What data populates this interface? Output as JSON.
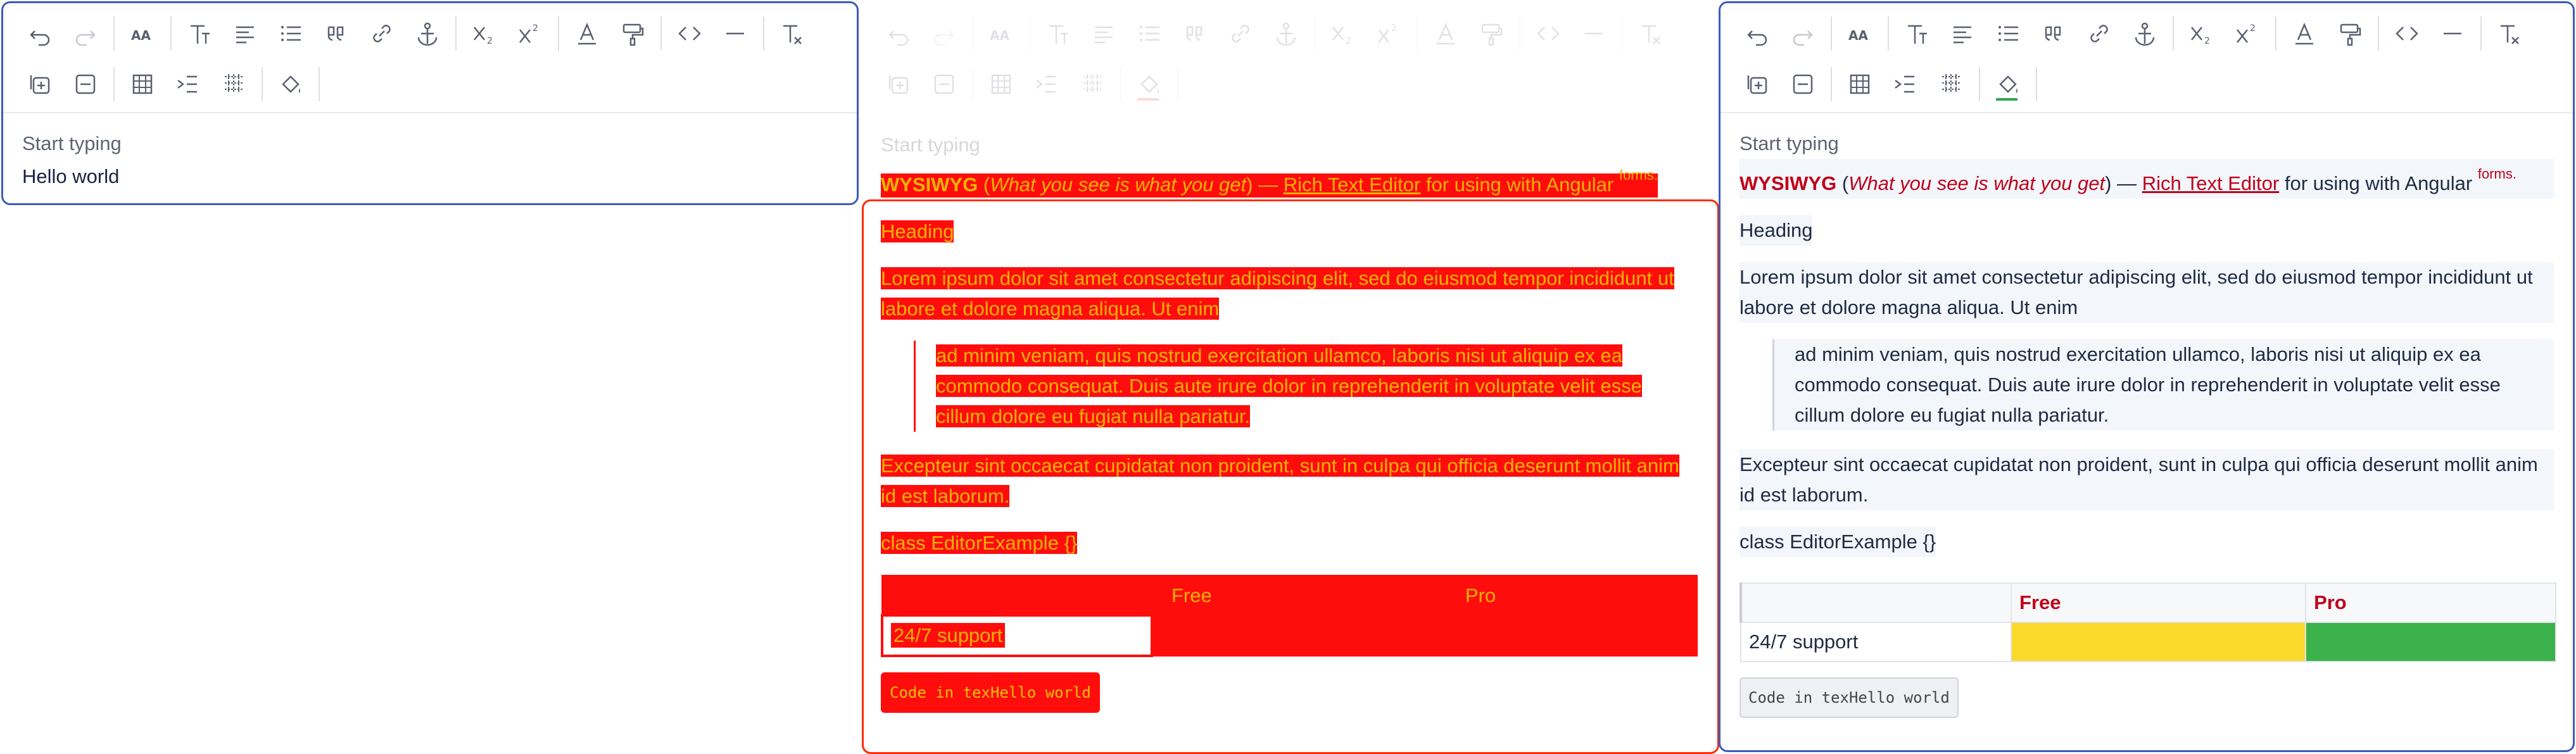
{
  "editors": [
    {
      "placeholder": "Start typing",
      "content": "Hello world"
    },
    {
      "placeholder": "Start typing",
      "wysiwyg": "WYSIWYG",
      "paren_open": " (",
      "wysiwyg_meaning": "What you see is what you get",
      "paren_close": ") — ",
      "rte": "Rich Text Editor",
      "for_angular": " for using with Angular ",
      "forms": "forms.",
      "heading": "Heading",
      "lorem": "Lorem ipsum dolor sit amet consectetur adipiscing elit, sed do eiusmod tempor incididunt ut labore et dolore magna aliqua. Ut enim",
      "quote": "ad minim veniam, quis nostrud exercitation ullamco, laboris nisi ut aliquip ex ea commodo consequat. Duis aute irure dolor in reprehenderit in voluptate velit esse cillum dolore eu fugiat nulla pariatur.",
      "excepteur": "Excepteur sint occaecat cupidatat non proident, sunt in culpa qui officia deserunt mollit anim id est laborum.",
      "class_line": "class EditorExample {}",
      "table": {
        "headers": [
          "",
          "Free",
          "Pro"
        ],
        "rows": [
          [
            "24/7 support",
            "",
            ""
          ]
        ]
      },
      "code": "Code in texHello world"
    },
    {
      "placeholder": "Start typing",
      "wysiwyg": "WYSIWYG",
      "paren_open": " (",
      "wysiwyg_meaning": "What you see is what you get",
      "paren_close": ") — ",
      "rte": "Rich Text Editor",
      "for_angular": " for using with Angular ",
      "forms": "forms.",
      "heading": "Heading",
      "lorem": "Lorem ipsum dolor sit amet consectetur adipiscing elit, sed do eiusmod tempor incididunt ut labore et dolore magna aliqua. Ut enim",
      "quote": "ad minim veniam, quis nostrud exercitation ullamco, laboris nisi ut aliquip ex ea commodo consequat. Duis aute irure dolor in reprehenderit in voluptate velit esse cillum dolore eu fugiat nulla pariatur.",
      "excepteur": "Excepteur sint occaecat cupidatat non proident, sunt in culpa qui officia deserunt mollit anim id est laborum.",
      "class_line": "class EditorExample {}",
      "table": {
        "headers": [
          "",
          "Free",
          "Pro"
        ],
        "rows": [
          [
            "24/7 support",
            "",
            ""
          ]
        ]
      },
      "code": "Code in texHello world"
    }
  ],
  "toolbar_icons": [
    "undo-icon",
    "redo-icon",
    "font-size-icon",
    "text-style-icon",
    "align-icon",
    "list-icon",
    "quote-icon",
    "link-icon",
    "anchor-icon",
    "subscript-icon",
    "superscript-icon",
    "text-color-icon",
    "highlight-icon",
    "code-icon",
    "horizontal-rule-icon",
    "clear-format-icon",
    "insert-row-icon",
    "delete-row-icon",
    "table-icon",
    "indent-icon",
    "table-grid-icon",
    "fill-color-icon"
  ],
  "colors": {
    "border": "#3b5bbf",
    "accent": "#c0001a",
    "overlay": "#ff0d0d",
    "cell_yellow": "#fbd92a",
    "cell_green": "#3bb24b"
  }
}
